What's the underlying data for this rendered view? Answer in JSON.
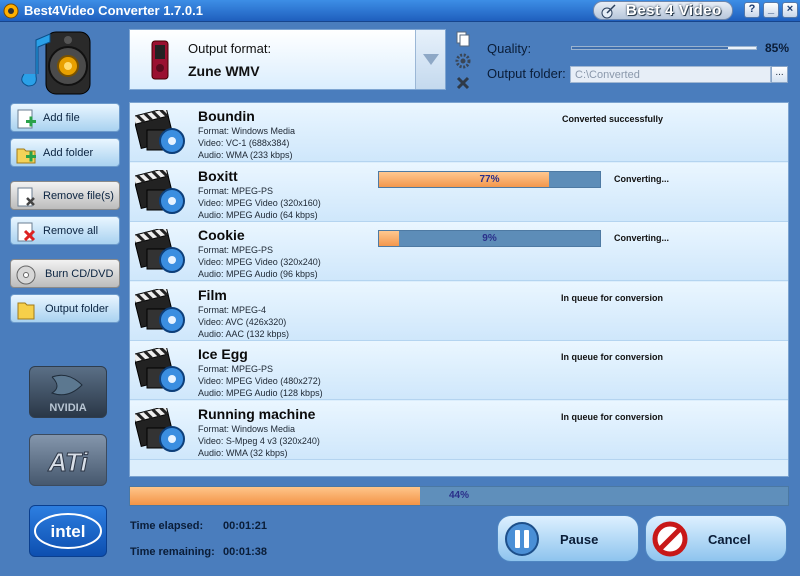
{
  "window": {
    "title": "Best4Video Converter 1.7.0.1",
    "brand": "Best 4 Video",
    "controls": [
      "?",
      "_",
      "×"
    ]
  },
  "toolbar": {
    "add_file": "Add file",
    "add_folder": "Add folder",
    "remove_files": "Remove file(s)",
    "remove_all": "Remove all",
    "burn": "Burn CD/DVD",
    "output_folder": "Output folder"
  },
  "gpu_badges": [
    "NVIDIA",
    "ATi",
    "intel"
  ],
  "output": {
    "format_label": "Output format:",
    "format_value": "Zune WMV",
    "quality_label": "Quality:",
    "quality_value": "85%",
    "quality_level": 0.85,
    "folder_label": "Output folder:",
    "folder_value": "C:\\Converted",
    "browse_label": "..."
  },
  "files": [
    {
      "name": "Boundin",
      "format": "Format: Windows Media",
      "video": "Video: VC-1 (688x384)",
      "audio": "Audio: WMA (233 kbps)",
      "status": "Converted successfully",
      "progress": null
    },
    {
      "name": "Boxitt",
      "format": "Format: MPEG-PS",
      "video": "Video: MPEG Video (320x160)",
      "audio": "Audio: MPEG Audio (64 kbps)",
      "status": "Converting...",
      "progress": "77%",
      "progress_level": 0.77
    },
    {
      "name": "Cookie",
      "format": "Format: MPEG-PS",
      "video": "Video: MPEG Video (320x240)",
      "audio": "Audio: MPEG Audio (96 kbps)",
      "status": "Converting...",
      "progress": "9%",
      "progress_level": 0.09
    },
    {
      "name": "Film",
      "format": "Format: MPEG-4",
      "video": "Video: AVC (426x320)",
      "audio": "Audio: AAC (132 kbps)",
      "status": "In queue for conversion",
      "progress": null
    },
    {
      "name": "Ice Egg",
      "format": "Format: MPEG-PS",
      "video": "Video: MPEG Video (480x272)",
      "audio": "Audio: MPEG Audio (128 kbps)",
      "status": "In queue for conversion",
      "progress": null
    },
    {
      "name": "Running machine",
      "format": "Format: Windows Media",
      "video": "Video: S-Mpeg 4 v3 (320x240)",
      "audio": "Audio: WMA (32 kbps)",
      "status": "In queue for conversion",
      "progress": null
    }
  ],
  "overall": {
    "progress": "44%",
    "progress_level": 0.44
  },
  "time": {
    "elapsed_label": "Time elapsed:",
    "elapsed_value": "00:01:21",
    "remaining_label": "Time remaining:",
    "remaining_value": "00:01:38"
  },
  "actions": {
    "pause": "Pause",
    "cancel": "Cancel"
  },
  "colors": {
    "accent": "#3d8ee6",
    "progress": "#f3974d",
    "background": "#4a7dbd"
  }
}
